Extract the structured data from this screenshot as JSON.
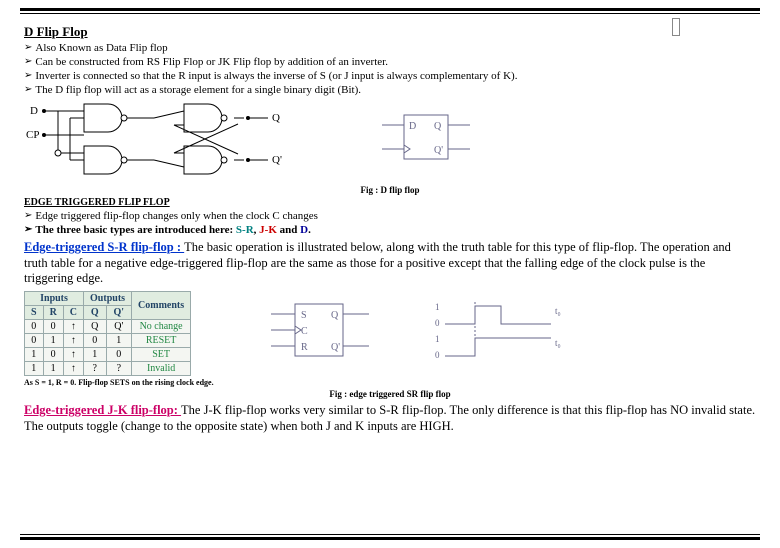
{
  "title": "D Flip Flop",
  "bullets_d": [
    "Also Known as Data Flip flop",
    "Can be constructed from RS Flip Flop or JK Flip flop by addition of an inverter.",
    "Inverter is connected so that the R input is always the inverse of S (or J input is always complementary of K).",
    "The D flip flop will act as a storage element for a single binary digit (Bit)."
  ],
  "dff_caption": "Fig : D flip flop",
  "edge_heading": "EDGE TRIGGERED FLIP FLOP",
  "bullets_edge": [
    "Edge triggered flip-flop changes only when the clock C changes"
  ],
  "edge_types_prefix": "The three basic types are introduced here: ",
  "type_sr": "S-R",
  "type_jk": "J-K",
  "type_and": " and ",
  "type_d": "D",
  "sr_title": "Edge-triggered S-R flip-flop : ",
  "sr_text": "The basic operation is illustrated below, along with the truth table for this type of flip-flop. The operation and truth table for a negative edge-triggered flip-flop are the same as those for a positive except that the  falling edge of the clock pulse is the triggering edge.",
  "sr_table": {
    "headers_in": [
      "S",
      "R",
      "C"
    ],
    "headers_out": [
      "Q",
      "Q'"
    ],
    "header_comment": "Comments",
    "group_in": "Inputs",
    "group_out": "Outputs",
    "rows": [
      {
        "s": "0",
        "r": "0",
        "c": "↑",
        "q": "Q",
        "qn": "Q'",
        "comment": "No change"
      },
      {
        "s": "0",
        "r": "1",
        "c": "↑",
        "q": "0",
        "qn": "1",
        "comment": "RESET"
      },
      {
        "s": "1",
        "r": "0",
        "c": "↑",
        "q": "1",
        "qn": "0",
        "comment": "SET"
      },
      {
        "s": "1",
        "r": "1",
        "c": "↑",
        "q": "?",
        "qn": "?",
        "comment": "Invalid"
      }
    ]
  },
  "sr_note": "As S = 1, R = 0. Flip-flop SETS on the rising clock edge.",
  "sr_caption": "Fig : edge triggered SR flip flop",
  "jk_title": "Edge-triggered J-K flip-flop: ",
  "jk_text": "The J-K flip-flop works very similar to S-R flip-flop. The only difference is that this flip-flop has NO invalid state.  The outputs toggle (change to the opposite state) when both J and K inputs are HIGH.",
  "labels": {
    "D": "D",
    "CP": "CP",
    "Q": "Q",
    "Qn": "Q'",
    "S": "S",
    "R": "R",
    "C": "C",
    "t0": "t₀",
    "one": "1",
    "zero": "0"
  }
}
